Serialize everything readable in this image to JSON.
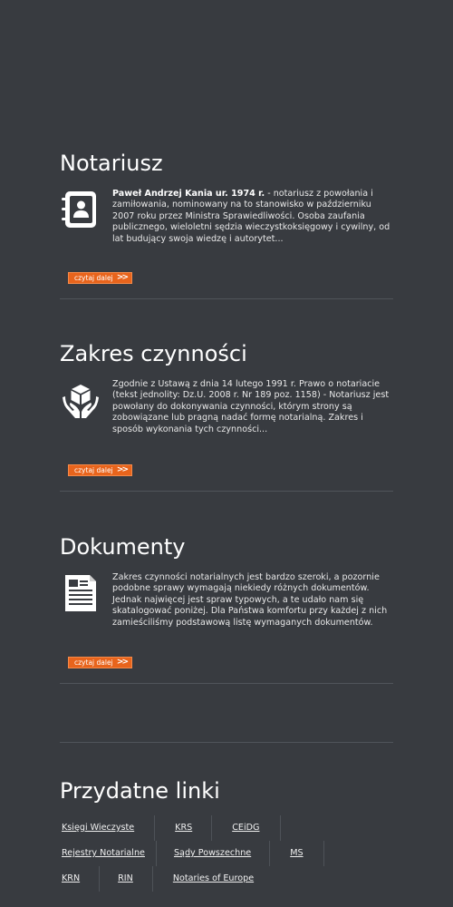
{
  "sections": [
    {
      "title": "Notariusz",
      "text_bold": "Paweł Andrzej Kania ur. 1974 r.",
      "text": " - notariusz z powołania i zamiłowania, nominowany na to stanowisko w październiku 2007 roku przez Ministra Sprawiedliwości. Osoba zaufania publicznego, wieloletni sędzia wieczystkoksięgowy i cywilny, od lat budujący swoja wiedzę i autorytet...",
      "icon": "address-book-icon",
      "button": "czytaj dalej"
    },
    {
      "title": "Zakres czynności",
      "text": "Zgodnie z Ustawą z dnia 14 lutego 1991 r. Prawo o notariacie (tekst jednolity: Dz.U. 2008 r. Nr 189 poz. 1158) - Notariusz jest powołany do dokonywania czynności, którym strony są zobowiązane lub pragną nadać formę notarialną. Zakres i sposób wykonania tych czynności...",
      "icon": "hands-box-icon",
      "button": "czytaj dalej"
    },
    {
      "title": "Dokumenty",
      "text": "Zakres czynności notarialnych jest bardzo szeroki, a pozornie podobne sprawy wymagają niekiedy różnych dokumentów. Jednak najwięcej jest spraw typowych, a te udało nam się skatalogować poniżej. Dla Państwa komfortu przy każdej z nich zamieściliśmy podstawową listę wymaganych dokumentów.",
      "icon": "document-icon",
      "button": "czytaj dalej"
    }
  ],
  "links": {
    "title": "Przydatne linki",
    "row1": [
      "Księgi Wieczyste",
      "KRS",
      "CEiDG"
    ],
    "row2": [
      "Rejestry Notarialne",
      "Sądy Powszechne",
      "MS"
    ],
    "row3": [
      "KRN",
      "RIN",
      "Notaries of Europe"
    ]
  },
  "colors": {
    "background": "#383b40",
    "button": "#e8641c",
    "divider": "#50545a"
  }
}
